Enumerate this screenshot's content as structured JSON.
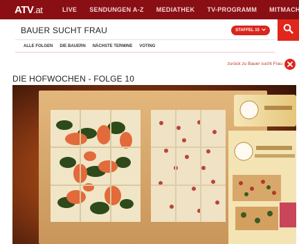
{
  "site": {
    "logo_main": "ATV",
    "logo_tld": ".at"
  },
  "nav": [
    "LIVE",
    "SENDUNGEN A-Z",
    "MEDIATHEK",
    "TV-PROGRAMM",
    "MITMACHEN"
  ],
  "show": {
    "title": "BAUER SUCHT FRAU",
    "season_label": "STAFFEL 15"
  },
  "subnav": [
    "ALLE FOLGEN",
    "DIE BAUERN",
    "NÄCHSTE TERMINE",
    "VOTING"
  ],
  "back_link": "zurück zu Bauer sucht Frau",
  "episode": {
    "title": "DIE HOFWOCHEN - FOLGE 10"
  },
  "colors": {
    "top_bar": "#8a0f14",
    "accent": "#e1261c"
  },
  "icons": {
    "search": "search-icon",
    "close": "close-icon",
    "dropdown": "chevron-down-icon"
  }
}
